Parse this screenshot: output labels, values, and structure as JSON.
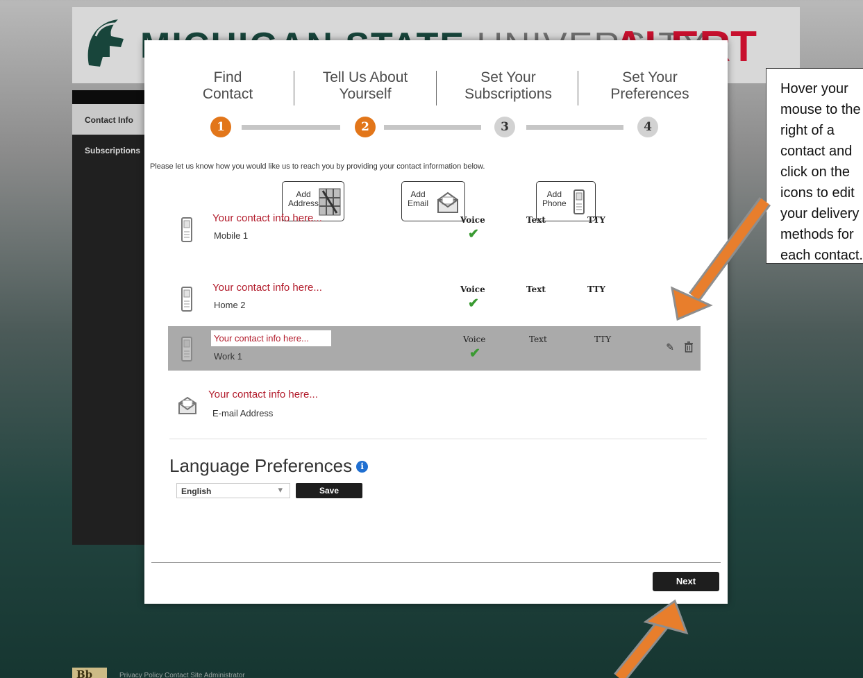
{
  "banner": {
    "title_bold": "MICHIGAN STATE",
    "title_thin": "UNIVERSITY",
    "alert": "ALERT",
    "logo": "spartan-helmet-icon"
  },
  "sidebar": {
    "items": [
      {
        "label": "Contact Info"
      },
      {
        "label": "Subscriptions"
      }
    ]
  },
  "steps": [
    {
      "label": "Find\nContact",
      "number": "1"
    },
    {
      "label": "Tell Us About\nYourself",
      "number": "2"
    },
    {
      "label": "Set Your\nSubscriptions",
      "number": "3"
    },
    {
      "label": "Set Your\nPreferences",
      "number": "4"
    }
  ],
  "intro": "Please let us know how you would like us to reach you by providing your contact information below.",
  "add_buttons": {
    "address": "Add\nAddress",
    "email": "Add\nEmail",
    "phone": "Add\nPhone"
  },
  "columns": {
    "voice": "Voice",
    "text": "Text",
    "tty": "TTY"
  },
  "contacts": [
    {
      "info": "Your contact info here...",
      "name": "Mobile 1",
      "icon": "phone-icon",
      "voice_checked": true
    },
    {
      "info": "Your contact info here...",
      "name": "Home 2",
      "icon": "phone-icon",
      "voice_checked": true
    },
    {
      "info": "Your contact info here...",
      "name": "Work 1",
      "icon": "phone-icon",
      "voice_checked": true
    },
    {
      "info": "Your contact info here...",
      "name": "E-mail Address",
      "icon": "email-icon"
    }
  ],
  "check_glyph": "✔",
  "edit_glyph": "✎",
  "language": {
    "title": "Language Preferences",
    "info_glyph": "i",
    "selected": "English",
    "caret": "▾",
    "save_label": "Save"
  },
  "next_label": "Next",
  "callout": {
    "text": "Hover your mouse to the right of a contact and click on the icons to edit your delivery methods for each contact."
  },
  "footer": {
    "logo_text": "Bb",
    "text": "Privacy Policy   Contact Site Administrator"
  },
  "colors": {
    "msu_green": "#18453b",
    "alert_red": "#c8102e",
    "step_active": "#e2761a",
    "arrow": "#e87e2c",
    "check": "#3a9a32"
  }
}
